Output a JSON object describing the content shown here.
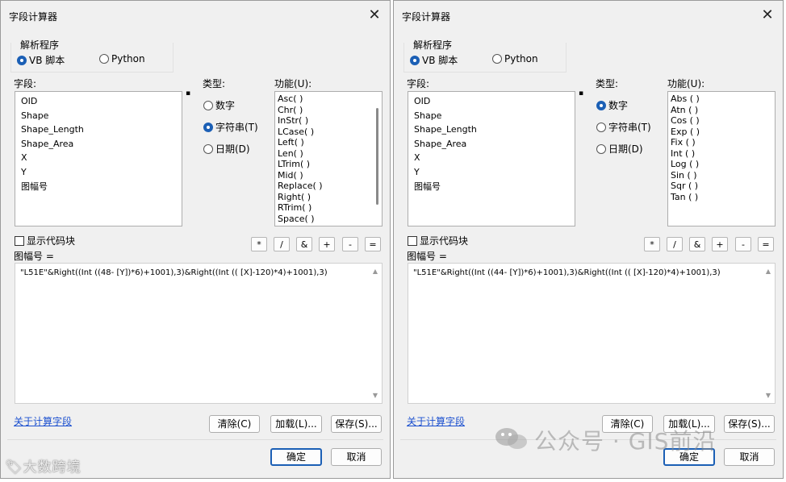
{
  "dialogs": [
    {
      "title": "字段计算器",
      "close": "✕",
      "parser": {
        "label": "解析程序",
        "options": [
          "VB 脚本",
          "Python"
        ],
        "selected": 0
      },
      "fields": {
        "label": "字段:",
        "items": [
          "OID",
          "Shape",
          "Shape_Length",
          "Shape_Area",
          "X",
          "Y",
          "图幅号"
        ]
      },
      "type": {
        "label": "类型:",
        "options": [
          "数字",
          "字符串(T)",
          "日期(D)"
        ],
        "selected": 1
      },
      "functions": {
        "label": "功能(U):",
        "items": [
          "Asc( )",
          "Chr( )",
          "InStr( )",
          "LCase( )",
          "Left( )",
          "Len( )",
          "LTrim( )",
          "Mid( )",
          "Replace( )",
          "Right( )",
          "RTrim( )",
          "Space( )"
        ]
      },
      "show_codeblock": "显示代码块",
      "operators": [
        "*",
        "/",
        "&",
        "+",
        "-",
        "="
      ],
      "expr_label": "图幅号 =",
      "expression": "\"L51E\"&Right((Int ((48- [Y])*6)+1001),3)&Right((Int (( [X]-120)*4)+1001),3)",
      "about_link": "关于计算字段",
      "buttons": {
        "clear": "清除(C)",
        "load": "加载(L)...",
        "save": "保存(S)...",
        "ok": "确定",
        "cancel": "取消"
      }
    },
    {
      "title": "字段计算器",
      "close": "✕",
      "parser": {
        "label": "解析程序",
        "options": [
          "VB 脚本",
          "Python"
        ],
        "selected": 0
      },
      "fields": {
        "label": "字段:",
        "items": [
          "OID",
          "Shape",
          "Shape_Length",
          "Shape_Area",
          "X",
          "Y",
          "图幅号"
        ]
      },
      "type": {
        "label": "类型:",
        "options": [
          "数字",
          "字符串(T)",
          "日期(D)"
        ],
        "selected": 0
      },
      "functions": {
        "label": "功能(U):",
        "items": [
          "Abs ( )",
          "Atn ( )",
          "Cos ( )",
          "Exp ( )",
          "Fix ( )",
          "Int ( )",
          "Log ( )",
          "Sin ( )",
          "Sqr ( )",
          "Tan ( )"
        ]
      },
      "show_codeblock": "显示代码块",
      "operators": [
        "*",
        "/",
        "&",
        "+",
        "-",
        "="
      ],
      "expr_label": "图幅号 =",
      "expression": "\"L51E\"&Right((Int ((44- [Y])*6)+1001),3)&Right((Int (( [X]-120)*4)+1001),3)",
      "about_link": "关于计算字段",
      "buttons": {
        "clear": "清除(C)",
        "load": "加载(L)...",
        "save": "保存(S)...",
        "ok": "确定",
        "cancel": "取消"
      }
    }
  ],
  "watermarks": {
    "left": "大数跨境",
    "right": "公众号 · GIS前沿"
  },
  "colors": {
    "accent": "#1b5fb5",
    "link": "#1a4fcf",
    "dialog_bg": "#f0f0f0"
  }
}
